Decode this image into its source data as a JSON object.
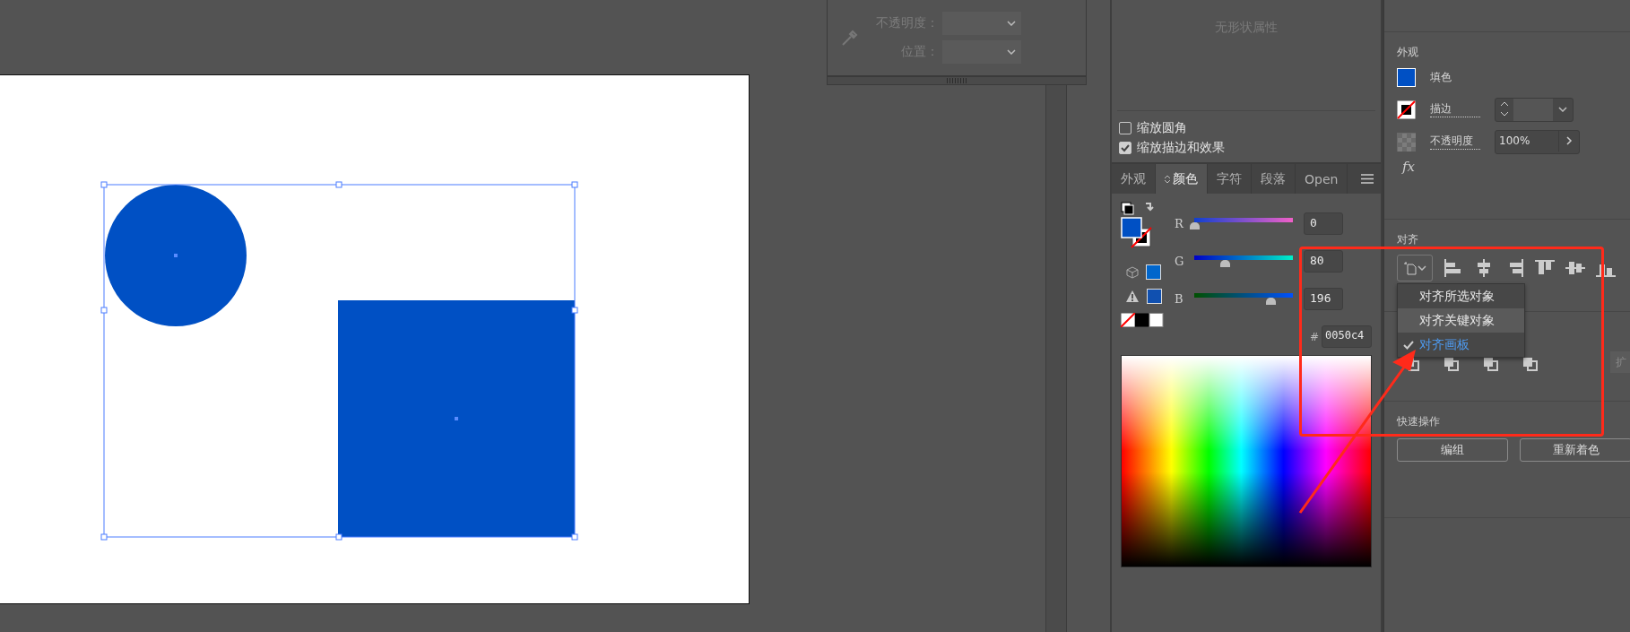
{
  "canvas": {
    "objects": [
      {
        "kind": "circle"
      },
      {
        "kind": "rectangle"
      }
    ]
  },
  "gradient_panel": {
    "disabled": true,
    "fields": [
      {
        "label": "不透明度："
      },
      {
        "label": "位置："
      }
    ]
  },
  "shape_panel": {
    "message": "无形状属性",
    "options": [
      {
        "label": "缩放圆角",
        "checked": false
      },
      {
        "label": "缩放描边和效果",
        "checked": true
      }
    ]
  },
  "color_panel": {
    "tabs": [
      {
        "label": "外观",
        "selected": false
      },
      {
        "label": "颜色",
        "selected": true
      },
      {
        "label": "字符",
        "selected": false
      },
      {
        "label": "段落",
        "selected": false
      },
      {
        "label": "Open",
        "selected": false
      }
    ],
    "channels": [
      {
        "name": "R",
        "level": 0,
        "value": "0"
      },
      {
        "name": "G",
        "level": 0.31,
        "value": "80"
      },
      {
        "name": "B",
        "level": 0.77,
        "value": "196"
      }
    ],
    "hex_label": "#",
    "hex": "0050c4"
  },
  "properties": {
    "appearance": {
      "title": "外观",
      "rows": [
        {
          "kind": "fill",
          "label": "填色"
        },
        {
          "kind": "stroke",
          "label": "描边"
        },
        {
          "kind": "opacity",
          "label": "不透明度",
          "value": "100%"
        }
      ],
      "effects": "fx"
    },
    "align": {
      "title": "对齐",
      "menu": [
        {
          "label": "对齐所选对象",
          "selected": false,
          "highlighted": false
        },
        {
          "label": "对齐关键对象",
          "selected": false,
          "highlighted": true
        },
        {
          "label": "对齐画板",
          "selected": true,
          "highlighted": false
        }
      ]
    },
    "expand_button": "扩",
    "quick_actions": {
      "title": "快速操作",
      "buttons": [
        "编组",
        "重新着色"
      ]
    }
  }
}
